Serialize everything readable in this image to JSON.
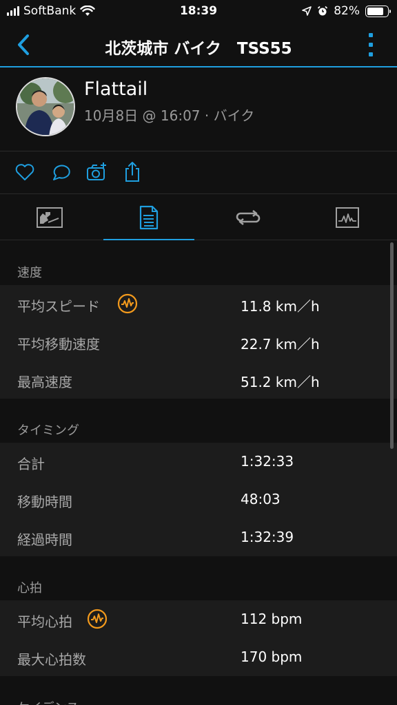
{
  "status_bar": {
    "carrier": "SoftBank",
    "time": "18:39",
    "battery": "82%",
    "battery_level": 0.82
  },
  "nav": {
    "title": "北茨城市 バイク　TSS55"
  },
  "profile": {
    "name": "Flattail",
    "meta": "10月8日 @ 16:07 · バイク"
  },
  "colors": {
    "accent": "#1f9fe0",
    "hr_badge": "#f39a1c"
  },
  "sections": [
    {
      "title": "速度",
      "rows": [
        {
          "label": "平均スピード",
          "value": "11.8 km／h",
          "badge": true
        },
        {
          "label": "平均移動速度",
          "value": "22.7 km／h",
          "badge": false
        },
        {
          "label": "最高速度",
          "value": "51.2 km／h",
          "badge": false
        }
      ]
    },
    {
      "title": "タイミング",
      "rows": [
        {
          "label": "合計",
          "value": "1:32:33",
          "badge": false
        },
        {
          "label": "移動時間",
          "value": "48:03",
          "badge": false
        },
        {
          "label": "経過時間",
          "value": "1:32:39",
          "badge": false
        }
      ]
    },
    {
      "title": "心拍",
      "rows": [
        {
          "label": "平均心拍",
          "value": "112 bpm",
          "badge": true
        },
        {
          "label": "最大心拍数",
          "value": "170 bpm",
          "badge": false
        }
      ]
    },
    {
      "title": "ケイデンス",
      "rows": []
    }
  ]
}
